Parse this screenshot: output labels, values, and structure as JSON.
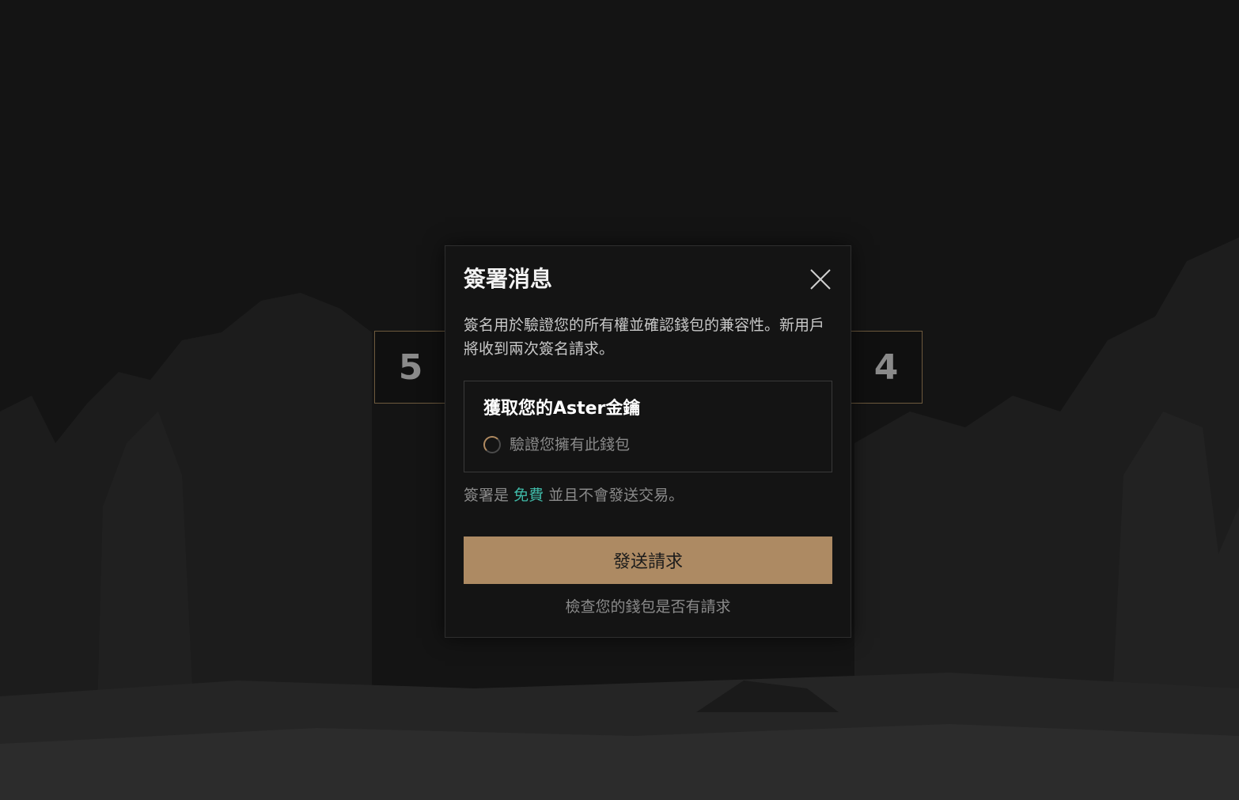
{
  "background": {
    "counters": [
      "5",
      "4"
    ]
  },
  "modal": {
    "title": "簽署消息",
    "description": "簽名用於驗證您的所有權並確認錢包的兼容性。新用戶將收到兩次簽名請求。",
    "task": {
      "title": "獲取您的Aster金鑰",
      "step_label": "驗證您擁有此錢包",
      "step_status": "loading"
    },
    "free_note": {
      "prefix": "簽署是",
      "highlight": "免費",
      "suffix": "並且不會發送交易。"
    },
    "send_button_label": "發送請求",
    "check_link_label": "檢查您的錢包是否有請求"
  },
  "colors": {
    "accent": "#ad8a63",
    "highlight": "#3fb8a6",
    "background": "#141414"
  },
  "icons": {
    "close": "close-icon",
    "spinner": "spinner-icon"
  }
}
